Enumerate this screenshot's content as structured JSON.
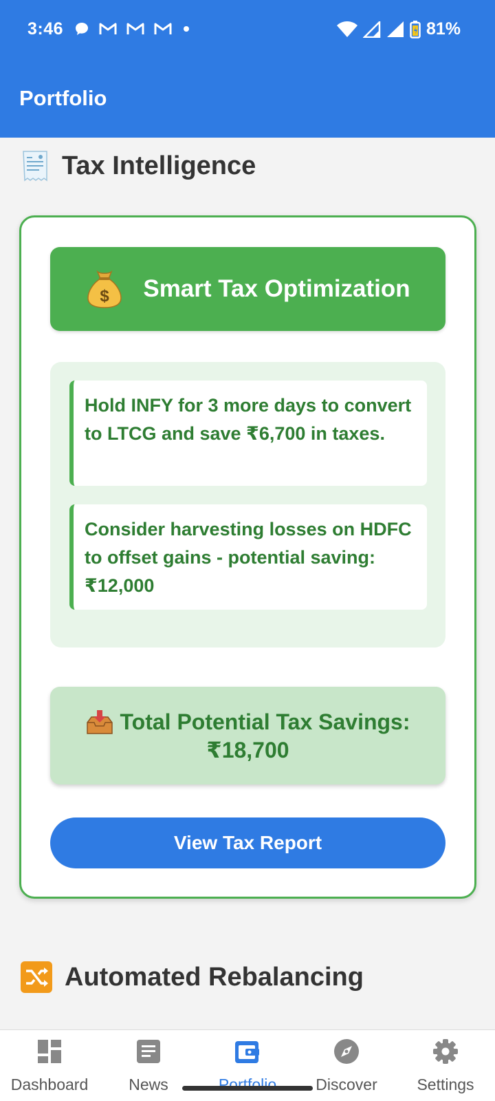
{
  "status_bar": {
    "time": "3:46",
    "battery": "81%",
    "icons": [
      "chat-bubble-icon",
      "gmail-icon",
      "gmail-icon",
      "gmail-icon",
      "dot-icon",
      "wifi-icon",
      "signal-icon",
      "signal-icon",
      "battery-icon"
    ]
  },
  "app_bar": {
    "title": "Portfolio"
  },
  "tax_section": {
    "icon": "receipt-icon",
    "title": "Tax Intelligence",
    "banner": {
      "icon": "money-bag-icon",
      "title": "Smart Tax Optimization"
    },
    "tips": [
      "Hold INFY for 3 more days to convert to LTCG and save ₹6,700 in taxes.",
      "Consider harvesting losses on HDFC to offset gains - potential saving: ₹12,000"
    ],
    "savings": {
      "icon": "inbox-tray-icon",
      "label": "Total Potential Tax Savings:",
      "amount": "₹18,700"
    },
    "report_button": "View Tax Report"
  },
  "rebalancing_section": {
    "icon": "shuffle-icon",
    "title": "Automated Rebalancing"
  },
  "bottom_nav": {
    "items": [
      {
        "label": "Dashboard",
        "icon": "dashboard-icon",
        "active": false
      },
      {
        "label": "News",
        "icon": "news-icon",
        "active": false
      },
      {
        "label": "Portfolio",
        "icon": "wallet-icon",
        "active": true
      },
      {
        "label": "Discover",
        "icon": "compass-icon",
        "active": false
      },
      {
        "label": "Settings",
        "icon": "gear-icon",
        "active": false
      }
    ]
  },
  "colors": {
    "primary": "#2f7be3",
    "green": "#4caf50",
    "dark_green": "#2e7d32",
    "light_green": "#e8f5e9",
    "savings_green": "#c8e6c9"
  }
}
